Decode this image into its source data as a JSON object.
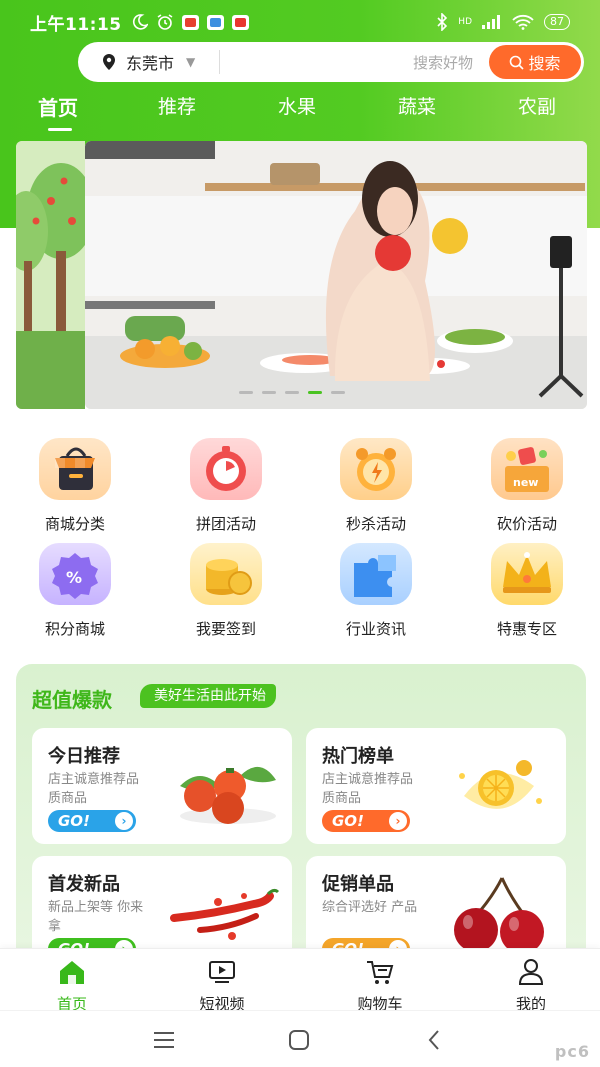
{
  "status": {
    "time": "上午11:15",
    "battery": "87",
    "network": "HD"
  },
  "search": {
    "city": "东莞市",
    "placeholder": "搜索好物",
    "button": "搜索"
  },
  "tabs": [
    {
      "label": "首页",
      "active": true
    },
    {
      "label": "推荐"
    },
    {
      "label": "水果"
    },
    {
      "label": "蔬菜"
    },
    {
      "label": "农副"
    }
  ],
  "banner": {
    "dots": 5,
    "active_dot": 4
  },
  "categories": [
    {
      "label": "商城分类",
      "icon": "shop-bag-icon"
    },
    {
      "label": "拼团活动",
      "icon": "timer-icon"
    },
    {
      "label": "秒杀活动",
      "icon": "alarm-clock-icon"
    },
    {
      "label": "砍价活动",
      "icon": "gift-box-icon"
    },
    {
      "label": "积分商城",
      "icon": "percent-coupon-icon"
    },
    {
      "label": "我要签到",
      "icon": "coins-icon"
    },
    {
      "label": "行业资讯",
      "icon": "puzzle-icon"
    },
    {
      "label": "特惠专区",
      "icon": "crown-icon"
    }
  ],
  "special": {
    "title": "超值爆款",
    "tag": "美好生活由此开始",
    "cards": [
      {
        "title": "今日推荐",
        "subtitle": "店主诚意推荐品质商品",
        "go": "GO!",
        "go_color": "#2aa3e8",
        "image": "persimmon-image"
      },
      {
        "title": "热门榜单",
        "subtitle": "店主诚意推荐品质商品",
        "go": "GO!",
        "go_color": "#ff6a2b",
        "image": "orange-slice-image"
      },
      {
        "title": "首发新品",
        "subtitle": "新品上架等 你来拿",
        "go": "GO!",
        "go_color": "#3fbf1e",
        "image": "chili-pepper-image"
      },
      {
        "title": "促销单品",
        "subtitle": "综合评选好 产品",
        "go": "GO!",
        "go_color": "#f4a52a",
        "image": "cherry-image"
      }
    ]
  },
  "bottom_nav": [
    {
      "label": "首页",
      "icon": "home-icon",
      "active": true
    },
    {
      "label": "短视频",
      "icon": "video-icon"
    },
    {
      "label": "购物车",
      "icon": "cart-icon"
    },
    {
      "label": "我的",
      "icon": "user-icon"
    }
  ],
  "watermark": "pc6",
  "colors": {
    "brand_green": "#49c51c",
    "search_button": "#ff6a2b",
    "active_tab": "#38b81a"
  }
}
